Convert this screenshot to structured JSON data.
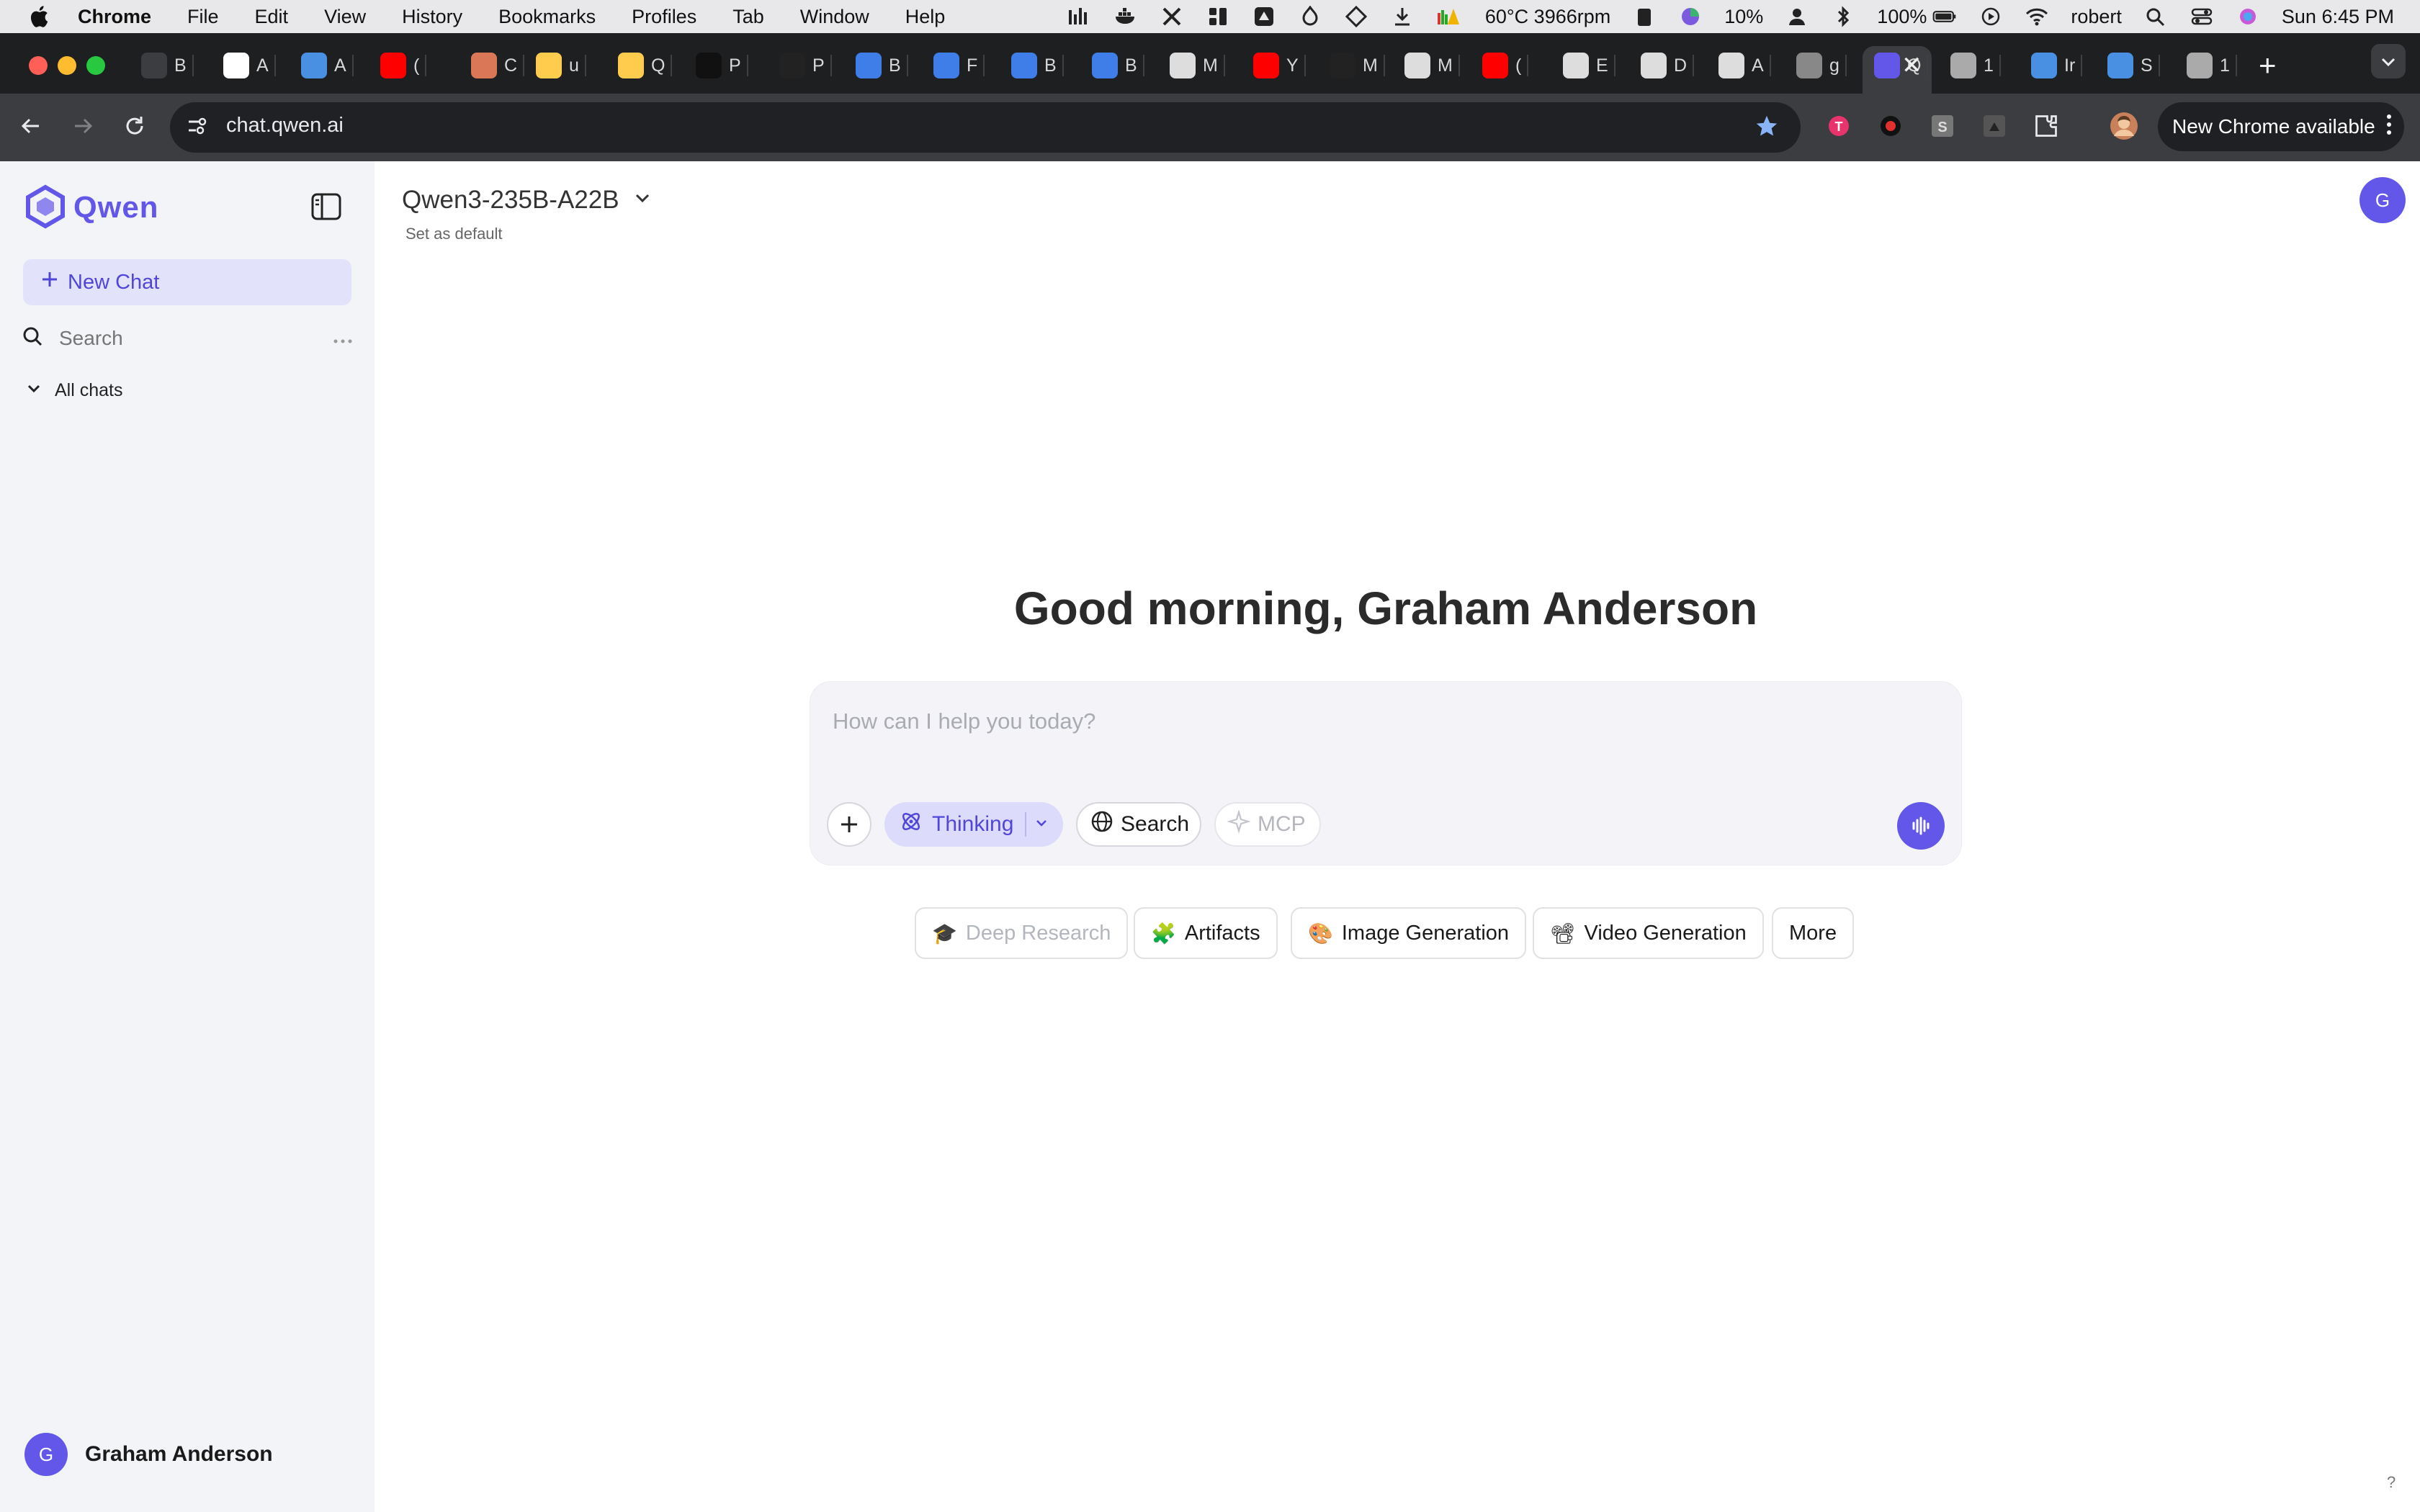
{
  "menubar": {
    "app_name": "Chrome",
    "items": [
      "File",
      "Edit",
      "View",
      "History",
      "Bookmarks",
      "Profiles",
      "Tab",
      "Window",
      "Help"
    ],
    "status": {
      "temp": "60°C 3966rpm",
      "cpu": "10%",
      "battery": "100%",
      "user": "robert",
      "clock": "Sun  6:45 PM"
    }
  },
  "tabs": [
    {
      "letter": "B",
      "icon": "anthropic-a-icon",
      "color": "#3b3d40"
    },
    {
      "letter": "A",
      "icon": "anthropic-icon",
      "color": "#ffffff"
    },
    {
      "letter": "A",
      "icon": "lifebuoy-icon",
      "color": "#4a90e2"
    },
    {
      "letter": "(",
      "icon": "youtube-icon",
      "color": "#ff0000"
    },
    {
      "letter": "C",
      "icon": "claude-icon",
      "color": "#d97757"
    },
    {
      "letter": "u",
      "icon": "hugging-face-icon",
      "color": "#ffcc4d"
    },
    {
      "letter": "Q",
      "icon": "hugging-face-icon",
      "color": "#ffcc4d"
    },
    {
      "letter": "P",
      "icon": "openai-icon",
      "color": "#111111"
    },
    {
      "letter": "P",
      "icon": "perplexity-icon",
      "color": "#222222"
    },
    {
      "letter": "B",
      "icon": "info-icon",
      "color": "#3f7ee8"
    },
    {
      "letter": "F",
      "icon": "info-circle-icon",
      "color": "#3f7ee8"
    },
    {
      "letter": "B",
      "icon": "info-icon",
      "color": "#3f7ee8"
    },
    {
      "letter": "B",
      "icon": "info-icon",
      "color": "#3f7ee8"
    },
    {
      "letter": "M",
      "icon": "ollama-icon",
      "color": "#dddddd"
    },
    {
      "letter": "Y",
      "icon": "youtube-icon",
      "color": "#ff0000"
    },
    {
      "letter": "M",
      "icon": "ollama-icon",
      "color": "#222222"
    },
    {
      "letter": "M",
      "icon": "ollama-icon",
      "color": "#dddddd"
    },
    {
      "letter": "(",
      "icon": "youtube-icon",
      "color": "#ff0000"
    },
    {
      "letter": "E",
      "icon": "puzzle-icon",
      "color": "#dddddd"
    },
    {
      "letter": "D",
      "icon": "dc-icon",
      "color": "#dddddd"
    },
    {
      "letter": "A",
      "icon": "anthropic-a-icon",
      "color": "#dddddd"
    },
    {
      "letter": "g",
      "icon": "loading-icon",
      "color": "#888888"
    },
    {
      "letter": "Q",
      "icon": "qwen-icon",
      "color": "#6257e8"
    },
    {
      "letter": "1",
      "icon": "globe-icon",
      "color": "#aaaaaa"
    },
    {
      "letter": "Ir",
      "icon": "lifebuoy-icon",
      "color": "#4a90e2"
    },
    {
      "letter": "S",
      "icon": "lifebuoy-icon",
      "color": "#4a90e2"
    },
    {
      "letter": "1",
      "icon": "globe-icon",
      "color": "#aaaaaa"
    }
  ],
  "browser": {
    "url": "chat.qwen.ai",
    "update_label": "New Chrome available"
  },
  "sidebar": {
    "logo_text": "Qwen",
    "new_chat": "New Chat",
    "search_placeholder": "Search",
    "all_chats": "All chats",
    "user_name": "Graham Anderson",
    "user_initial": "G"
  },
  "header": {
    "model": "Qwen3-235B-A22B",
    "set_default": "Set as default",
    "avatar_initial": "G"
  },
  "main": {
    "greeting": "Good morning, Graham Anderson",
    "input_placeholder": "How can I help you today?",
    "thinking": "Thinking",
    "search": "Search",
    "mcp": "MCP"
  },
  "chips": [
    {
      "emoji": "🎓",
      "label": "Deep Research",
      "disabled": true
    },
    {
      "emoji": "🧩",
      "label": "Artifacts"
    },
    {
      "emoji": "🎨",
      "label": "Image Generation"
    },
    {
      "emoji": "📽",
      "label": "Video Generation"
    },
    {
      "emoji": "",
      "label": "More"
    }
  ],
  "help_label": "?"
}
